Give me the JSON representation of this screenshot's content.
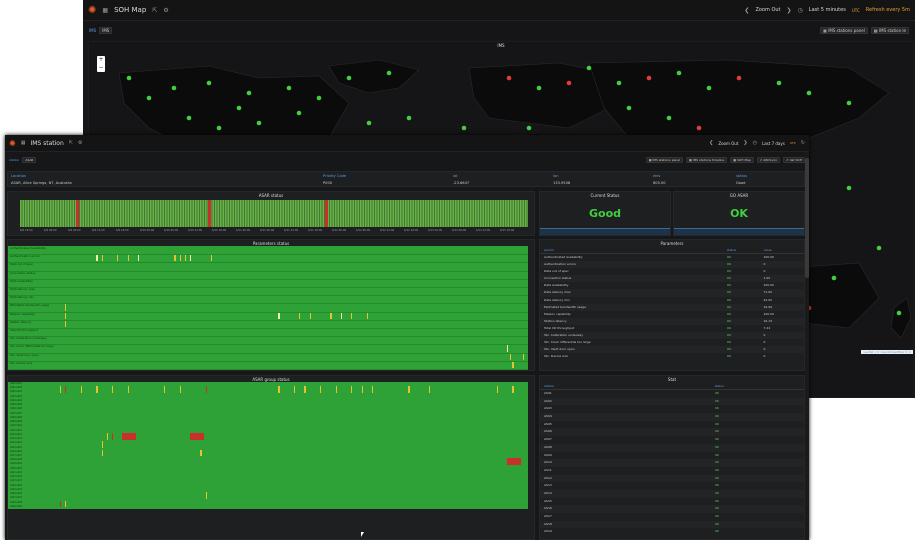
{
  "back": {
    "dashboard_title": "SOH Map",
    "zoom_out": "Zoom Out",
    "time_range": "Last 5 minutes",
    "utc": "UTC",
    "refresh": "Refresh every 5m",
    "var_label": "IMS",
    "var_value": "IMS",
    "map_title": "IMS",
    "links": [
      "IMS stations panel",
      "IMS station le"
    ],
    "attribution": "Leaflet | © OpenStreetMap © C"
  },
  "front": {
    "dashboard_title": "IMS station",
    "zoom_out": "Zoom Out",
    "time_range": "Last 7 days",
    "utc": "UTC",
    "var_label": "station",
    "var_value": "ASAR",
    "links": [
      "IMS stations panel",
      "IMS stations timeline",
      "SOH Map",
      "ARCS.pro",
      "dat SOH"
    ],
    "info": {
      "headers": [
        "Location",
        "Priority Code",
        "lat",
        "lon",
        "elev",
        "status"
      ],
      "values": [
        "ASAR, Alice Springs, NT, Australia",
        "P000",
        "-23.6647",
        "133.9508",
        "605.00",
        "Good"
      ]
    },
    "asar_status_title": "ASAR status",
    "timeline_ticks": [
      "6/6 18:00",
      "6/9 00:00",
      "6/9 06:00",
      "6/9 12:00",
      "6/9 18:00",
      "6/10 00:00",
      "6/10 06:00",
      "6/10 12:00",
      "6/10 18:00",
      "6/11 00:00",
      "6/11 06:00",
      "6/11 12:00",
      "6/11 18:00",
      "6/12 00:00",
      "6/12 06:00",
      "6/12 12:00",
      "6/12 18:00",
      "6/13 00:00",
      "6/13 06:00",
      "6/13 12:00",
      "6/13 18:00"
    ],
    "current_status": {
      "title": "Current Status",
      "value": "Good"
    },
    "go_asar": {
      "title": "GO ASAR",
      "value": "OK"
    },
    "parameters_status_title": "Parameters status",
    "parameters_title": "Parameters",
    "param_headers": [
      "param",
      "status",
      "value"
    ],
    "params": [
      {
        "name": "Authenticated Availability",
        "status": "OK",
        "value": "100.00"
      },
      {
        "name": "Authentication errors",
        "status": "OK",
        "value": "0"
      },
      {
        "name": "Data out of spec",
        "status": "OK",
        "value": "0"
      },
      {
        "name": "Connection status",
        "status": "OK",
        "value": "1.00"
      },
      {
        "name": "Data Availability",
        "status": "OK",
        "value": "100.00"
      },
      {
        "name": "Data latency max",
        "status": "OK",
        "value": "71.00"
      },
      {
        "name": "Data latency min",
        "status": "OK",
        "value": "42.00"
      },
      {
        "name": "Estimated bandwidth usage",
        "status": "OK",
        "value": "16.99"
      },
      {
        "name": "Mission capability",
        "status": "OK",
        "value": "100.00"
      },
      {
        "name": "Station latency",
        "status": "OK",
        "value": "16.13"
      },
      {
        "name": "Total CD throughput",
        "status": "OK",
        "value": "7.44"
      },
      {
        "name": "Stn. Calibration underway",
        "status": "OK",
        "value": "0"
      },
      {
        "name": "Stn. Clock differential too large",
        "status": "OK",
        "value": "0"
      },
      {
        "name": "Stn. Vault door open",
        "status": "OK",
        "value": "0"
      },
      {
        "name": "Stn. Device lock",
        "status": "OK",
        "value": "0"
      }
    ],
    "group_status_title": "ASAR group status",
    "stat_title": "Stat",
    "group_headers": [
      "station",
      "status"
    ],
    "groups": [
      {
        "name": "AS01",
        "status": "OK"
      },
      {
        "name": "AS02",
        "status": "OK"
      },
      {
        "name": "AS03",
        "status": "OK"
      },
      {
        "name": "AS04",
        "status": "OK"
      },
      {
        "name": "AS05",
        "status": "OK"
      },
      {
        "name": "AS06",
        "status": "OK"
      },
      {
        "name": "AS07",
        "status": "OK"
      },
      {
        "name": "AS08",
        "status": "OK"
      },
      {
        "name": "AS09",
        "status": "OK"
      },
      {
        "name": "AS10",
        "status": "OK"
      },
      {
        "name": "AS11",
        "status": "OK"
      },
      {
        "name": "AS12",
        "status": "OK"
      },
      {
        "name": "AS13",
        "status": "OK"
      },
      {
        "name": "AS14",
        "status": "OK"
      },
      {
        "name": "AS15",
        "status": "OK"
      },
      {
        "name": "AS16",
        "status": "OK"
      },
      {
        "name": "AS17",
        "status": "OK"
      },
      {
        "name": "AS18",
        "status": "OK"
      },
      {
        "name": "AS19",
        "status": "OK"
      }
    ],
    "group_rows": [
      "AS01-AS01",
      "AS01-AS02",
      "AS02-AS02",
      "AS03-AS03",
      "AS04-AS04",
      "AS05-AS05",
      "AS06-AS06",
      "AS07-AS07",
      "AS08-AS08",
      "AS09-AS09",
      "AS10-AS10",
      "AS11-AS11",
      "AS12-AS12",
      "AS13-AS13",
      "AS14-AS14",
      "AS15-AS15",
      "AS16-AS16",
      "AS17-AS17",
      "AS18-AS18",
      "AS19-AS19",
      "AS20-AS20",
      "AS21-AS21",
      "AS22-AS22",
      "AS23-AS23",
      "AS24-AS24",
      "AS25-AS25",
      "AS26-AS26",
      "AS27-AS27",
      "AS28-AS28",
      "AS29-AS29"
    ]
  },
  "colors": {
    "ok": "#2ea236",
    "warn": "#e5c52a",
    "crit": "#c9302c",
    "bg": "#161719",
    "text_ok": "#5bd45b",
    "link": "#5a9ee8"
  }
}
